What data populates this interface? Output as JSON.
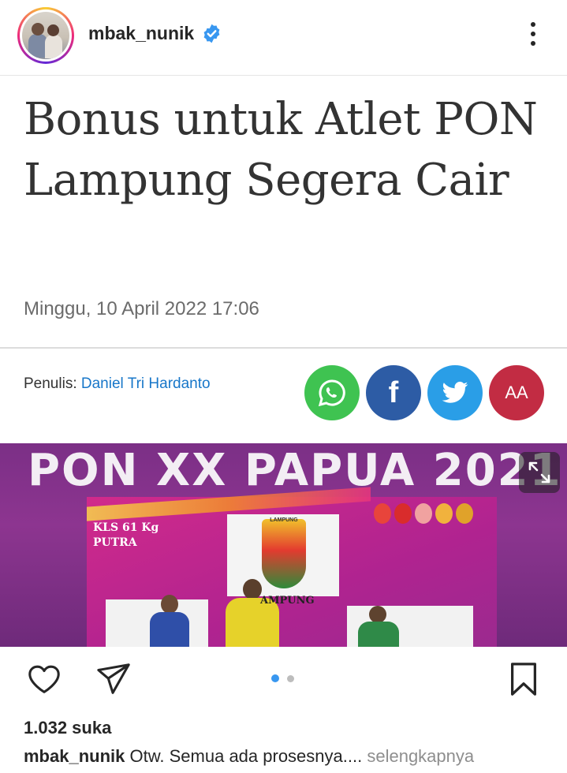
{
  "header": {
    "username": "mbak_nunik",
    "verified_icon": "verified-badge-icon",
    "more_icon": "more-vertical-icon"
  },
  "article": {
    "headline": "Bonus untuk Atlet PON Lampung Segera Cair",
    "date": "Minggu, 10 April 2022 17:06",
    "author_label": "Penulis:",
    "author_name": "Daniel Tri Hardanto",
    "share_buttons": [
      {
        "name": "whatsapp-share",
        "icon": "whatsapp-icon",
        "color": "#3fc351"
      },
      {
        "name": "facebook-share",
        "icon": "facebook-icon",
        "label": "f",
        "color": "#2d5ca5"
      },
      {
        "name": "twitter-share",
        "icon": "twitter-icon",
        "color": "#2a9ee7"
      },
      {
        "name": "font-size-button",
        "icon": "font-size-icon",
        "label": "AA",
        "color": "#c22c43"
      }
    ]
  },
  "photo": {
    "banner_text": "PON XX PAPUA 2021",
    "sign_text": "KLS 61 Kg PUTRA",
    "shield_label": "LAMPUNG",
    "podium_text": "AMPUNG",
    "expand_icon": "expand-icon"
  },
  "actions": {
    "like_icon": "heart-icon",
    "share_icon": "send-icon",
    "save_icon": "bookmark-icon",
    "carousel_index": 1,
    "carousel_count": 2
  },
  "likes": "1.032 suka",
  "caption": {
    "user": "mbak_nunik",
    "text": "Otw. Semua ada prosesnya....",
    "more": "selengkapnya"
  },
  "colors": {
    "accent": "#3897f0",
    "author_link": "#1877c9",
    "text": "#262626"
  }
}
